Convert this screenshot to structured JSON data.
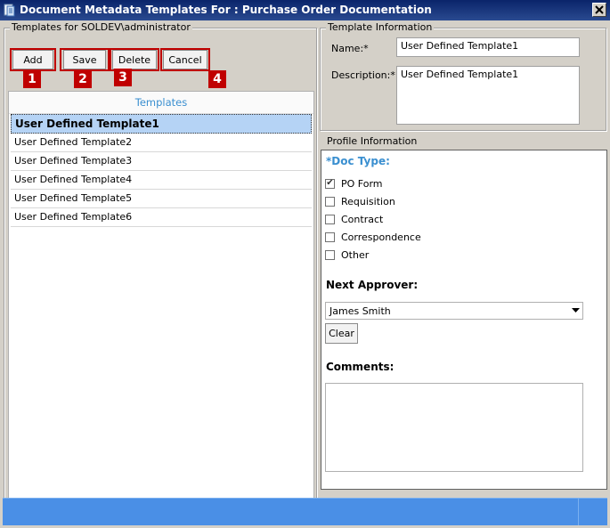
{
  "window": {
    "title": "Document Metadata Templates For : Purchase Order Documentation"
  },
  "templates_group": {
    "legend": "Templates for SOLDEV\\administrator",
    "buttons": {
      "add": "Add",
      "save": "Save",
      "delete": "Delete",
      "cancel": "Cancel"
    },
    "badges": [
      "1",
      "2",
      "3",
      "4"
    ],
    "list_header": "Templates",
    "items": [
      "User Defined Template1",
      "User Defined Template2",
      "User Defined Template3",
      "User Defined Template4",
      "User Defined Template5",
      "User Defined Template6"
    ],
    "selected_index": 0
  },
  "template_info": {
    "legend": "Template Information",
    "name_label": "Name:*",
    "name_value": "User Defined Template1",
    "description_label": "Description:*",
    "description_value": "User Defined Template1"
  },
  "profile": {
    "legend": "Profile Information",
    "doc_type_label": "*Doc Type:",
    "doc_types": [
      {
        "label": "PO Form",
        "checked": true
      },
      {
        "label": "Requisition",
        "checked": false
      },
      {
        "label": "Contract",
        "checked": false
      },
      {
        "label": "Correspondence",
        "checked": false
      },
      {
        "label": "Other",
        "checked": false
      }
    ],
    "next_approver_label": "Next Approver:",
    "next_approver_value": "James Smith",
    "clear_label": "Clear",
    "comments_label": "Comments:",
    "comments_value": ""
  },
  "colors": {
    "accent": "#3a8fd0",
    "highlight": "#c00000",
    "status": "#4a8fe6",
    "titlebar": "#0a246a"
  }
}
